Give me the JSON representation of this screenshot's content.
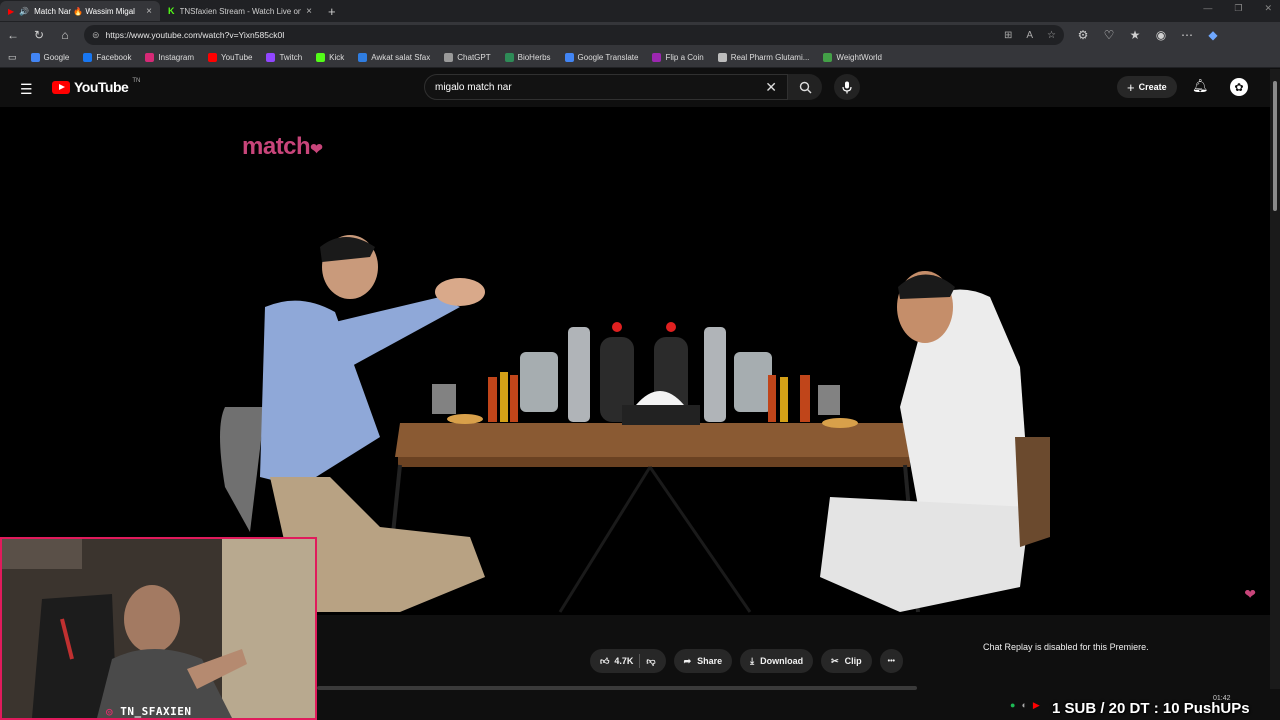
{
  "browser": {
    "tabs": [
      {
        "title": "Match Nar 🔥 Wassim Migal",
        "favicon_color": "#ff0000",
        "active": true
      },
      {
        "title": "TNSfaxien Stream - Watch Live on",
        "favicon_color": "#53fc18",
        "active": false
      }
    ],
    "new_tab_label": "+",
    "url": "https://www.youtube.com/watch?v=Yixn585ck0I",
    "bookmarks": [
      {
        "label": "Google",
        "color": "#4285f4"
      },
      {
        "label": "Facebook",
        "color": "#1877f2"
      },
      {
        "label": "Instagram",
        "color": "#d62976"
      },
      {
        "label": "YouTube",
        "color": "#ff0000"
      },
      {
        "label": "Twitch",
        "color": "#9146ff"
      },
      {
        "label": "Kick",
        "color": "#53fc18"
      },
      {
        "label": "Awkat salat Sfax",
        "color": "#2f7de1"
      },
      {
        "label": "ChatGPT",
        "color": "#9a9a9a"
      },
      {
        "label": "BioHerbs",
        "color": "#2e8b57"
      },
      {
        "label": "Google Translate",
        "color": "#4285f4"
      },
      {
        "label": "Flip a Coin",
        "color": "#9c27b0"
      },
      {
        "label": "Real Pharm Glutami...",
        "color": "#bdbdbd"
      },
      {
        "label": "WeightWorld",
        "color": "#43a047"
      }
    ]
  },
  "youtube": {
    "logo_text": "YouTube",
    "logo_country": "TN",
    "search_query": "migalo match nar",
    "create_label": "Create",
    "video_logo_text": "match",
    "actions": {
      "likes": "4.7K",
      "share": "Share",
      "download": "Download",
      "clip": "Clip",
      "more": "•••"
    },
    "chat_replay": "Chat Replay is disabled for this Premiere."
  },
  "stream": {
    "handle": "TN_SFAXIEN",
    "goal_overlay": "1 SUB / 20 DT : 10 PushUPs",
    "clock": "01:42"
  }
}
